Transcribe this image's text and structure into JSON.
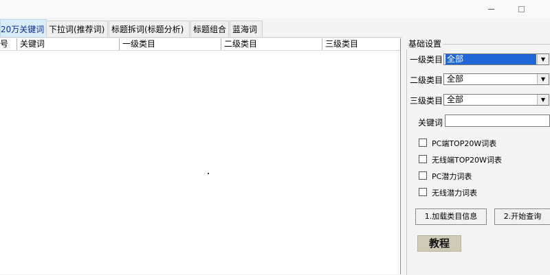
{
  "window": {
    "minimize_glyph": "",
    "maximize_glyph": ""
  },
  "tabs": [
    {
      "label": "20万关键词",
      "active": true
    },
    {
      "label": "下拉词(推荐词)",
      "active": false
    },
    {
      "label": "标题拆词(标题分析)",
      "active": false
    },
    {
      "label": "标题组合",
      "active": false
    },
    {
      "label": "蓝海词",
      "active": false
    }
  ],
  "table": {
    "columns": [
      "号",
      "关键词",
      "一级类目",
      "二级类目",
      "三级类目"
    ],
    "rows": []
  },
  "settings": {
    "group_title": "基础设置",
    "category1": {
      "label": "一级类目",
      "value": "全部"
    },
    "category2": {
      "label": "二级类目",
      "value": "全部"
    },
    "category3": {
      "label": "三级类目",
      "value": "全部"
    },
    "keyword": {
      "label": "关键词",
      "value": ""
    },
    "checkboxes": [
      {
        "label": "PC端TOP20W词表",
        "checked": false
      },
      {
        "label": "无线端TOP20W词表",
        "checked": false
      },
      {
        "label": "PC潜力词表",
        "checked": false
      },
      {
        "label": "无线潜力词表",
        "checked": false
      }
    ],
    "load_button": "1.加载类目信息",
    "query_button": "2.开始查询",
    "tutorial_button": "教程"
  },
  "colors": {
    "selection": "#1f66d6",
    "active_tab": "#d9ecf7",
    "tutorial_bg": "#cfcab6"
  }
}
